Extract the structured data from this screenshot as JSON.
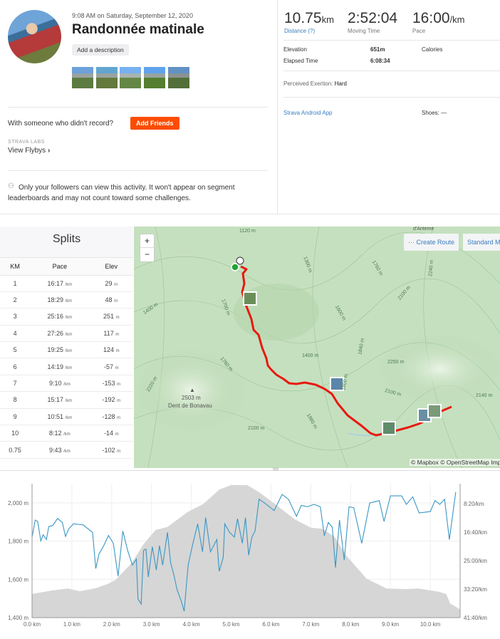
{
  "header": {
    "date": "9:08 AM on Saturday, September 12, 2020",
    "title": "Randonnée matinale",
    "add_description": "Add a description",
    "photo_count": 5
  },
  "friends": {
    "prompt": "With someone who didn't record?",
    "button": "Add Friends"
  },
  "labs": {
    "label": "STRAVA LABS",
    "link": "View Flybys",
    "chevron": "›"
  },
  "privacy": {
    "icon": "followers-icon",
    "text": "Only your followers can view this activity. It won't appear on segment leaderboards and may not count toward some challenges."
  },
  "stats": {
    "distance": {
      "value": "10.75",
      "unit": "km",
      "label": "Distance (?)"
    },
    "moving_time": {
      "value": "2:52:04",
      "label": "Moving Time"
    },
    "pace": {
      "value": "16:00",
      "unit": "/km",
      "label": "Pace"
    },
    "elevation": {
      "label": "Elevation",
      "value": "651m"
    },
    "calories": {
      "label": "Calories"
    },
    "elapsed": {
      "label": "Elapsed Time",
      "value": "6:08:34"
    },
    "exertion": {
      "label": "Perceived Exertion:",
      "value": "Hard"
    },
    "device": "Strava Android App",
    "shoes": {
      "label": "Shoes:",
      "value": "—"
    }
  },
  "splits": {
    "title": "Splits",
    "headers": [
      "KM",
      "Pace",
      "Elev"
    ],
    "pace_unit": "/km",
    "elev_unit": "m",
    "rows": [
      [
        "1",
        "16:17",
        "29"
      ],
      [
        "2",
        "18:29",
        "48"
      ],
      [
        "3",
        "25:16",
        "251"
      ],
      [
        "4",
        "27:26",
        "117"
      ],
      [
        "5",
        "19:25",
        "124"
      ],
      [
        "6",
        "14:19",
        "-57"
      ],
      [
        "7",
        "9:10",
        "-153"
      ],
      [
        "8",
        "15:17",
        "-192"
      ],
      [
        "9",
        "10:51",
        "-128"
      ],
      [
        "10",
        "8:12",
        "-14"
      ],
      [
        "0.75",
        "9:43",
        "-102"
      ]
    ]
  },
  "map": {
    "zoom_in": "+",
    "zoom_out": "−",
    "create_route": "Create Route",
    "standard_map": "Standard Map",
    "attribution": "© Mapbox © OpenStreetMap Improve this map",
    "labels": {
      "peak_elev": "2503 m",
      "peak_name": "Dent de Bonavau",
      "top": "d'Anteme",
      "c1": "1120 m",
      "c2": "1400 m",
      "c3": "1700 m",
      "c4": "1300 m",
      "c5": "1760 m",
      "c6": "2240 m",
      "c7": "2100 m",
      "c8": "1600 m",
      "c9": "1400 m",
      "c10": "1840 m",
      "c11": "2250 m",
      "c12": "1760 m",
      "c13": "2220 m",
      "c14": "2100 m",
      "c15": "1800 m",
      "c16": "2140 m",
      "c17": "2100 m",
      "c18": "1980 m",
      "c19": "140"
    },
    "route_color": "#e8190f",
    "start_color": "#1fa532"
  },
  "chart_data": {
    "type": "area+line",
    "x_ticks": [
      "0.0 km",
      "1.0 km",
      "2.0 km",
      "3.0 km",
      "4.0 km",
      "5.0 km",
      "6.0 km",
      "7.0 km",
      "8.0 km",
      "9.0 km",
      "10.0 km"
    ],
    "y_left_ticks": [
      "1,400 m",
      "1,600 m",
      "1,800 m",
      "2,000 m"
    ],
    "y_right_ticks": [
      "8:20/km",
      "16:40/km",
      "25:00/km",
      "33:20/km",
      "41:40/km"
    ],
    "xlim": [
      0,
      10.75
    ],
    "ylim_elevation": [
      1400,
      2100
    ],
    "ylim_pace_min_per_km": [
      2.45,
      41.67
    ],
    "grid": true,
    "elevation": {
      "color": "#d6d6d6",
      "x": [
        0,
        0.5,
        0.9,
        1.2,
        1.6,
        1.9,
        2.1,
        2.5,
        2.8,
        3.1,
        3.4,
        3.9,
        4.3,
        4.7,
        5.0,
        5.4,
        5.7,
        6.1,
        6.6,
        7.0,
        7.3,
        7.6,
        7.9,
        8.4,
        8.9,
        9.4,
        9.7,
        10.2,
        10.4,
        10.5,
        10.75
      ],
      "y": [
        1524,
        1542,
        1552,
        1538,
        1554,
        1576,
        1598,
        1685,
        1784,
        1858,
        1874,
        1951,
        1994,
        2069,
        2093,
        2093,
        2056,
        1994,
        1914,
        1870,
        1864,
        1821,
        1722,
        1604,
        1552,
        1549,
        1552,
        1536,
        1524,
        1474,
        1443
      ]
    },
    "pace": {
      "color": "#3a96c4",
      "x": [
        0,
        0.08,
        0.14,
        0.22,
        0.28,
        0.36,
        0.42,
        0.52,
        0.64,
        0.76,
        0.84,
        0.92,
        1.04,
        1.28,
        1.52,
        1.6,
        1.68,
        1.8,
        1.92,
        2.04,
        2.16,
        2.28,
        2.4,
        2.52,
        2.62,
        2.66,
        2.74,
        2.8,
        2.86,
        2.92,
        3.02,
        3.12,
        3.2,
        3.28,
        3.4,
        3.48,
        3.56,
        3.64,
        3.76,
        3.82,
        3.92,
        4.02,
        4.16,
        4.28,
        4.36,
        4.48,
        4.64,
        4.7,
        4.8,
        4.84,
        4.96,
        5.08,
        5.16,
        5.28,
        5.36,
        5.44,
        5.52,
        5.6,
        5.7,
        5.84,
        6.08,
        6.28,
        6.44,
        6.64,
        6.76,
        6.92,
        7.08,
        7.24,
        7.34,
        7.44,
        7.54,
        7.62,
        7.72,
        7.84,
        7.96,
        8.08,
        8.28,
        8.48,
        8.72,
        8.84,
        9.0,
        9.28,
        9.4,
        9.56,
        9.72,
        10.0,
        10.12,
        10.24,
        10.36,
        10.48,
        10.64
      ],
      "y": [
        18.1,
        13.1,
        13.5,
        19.2,
        17.4,
        18.8,
        15.0,
        14.7,
        12.6,
        13.8,
        17.9,
        15.7,
        14.2,
        14.5,
        16.7,
        27.3,
        23.1,
        20.6,
        17.6,
        19.9,
        29.5,
        16.3,
        22.0,
        26.3,
        24.5,
        36.2,
        37.7,
        22.0,
        21.6,
        29.8,
        20.9,
        27.7,
        20.6,
        26.3,
        16.7,
        25.6,
        29.1,
        33.4,
        37.3,
        39.8,
        26.3,
        20.9,
        14.2,
        22.4,
        12.4,
        22.4,
        18.8,
        28.1,
        24.1,
        14.2,
        16.7,
        18.1,
        12.7,
        19.9,
        12.4,
        23.4,
        18.1,
        16.3,
        7.0,
        8.1,
        10.3,
        5.6,
        7.0,
        12.0,
        8.8,
        9.2,
        8.5,
        9.2,
        17.7,
        13.8,
        15.2,
        27.0,
        13.1,
        24.8,
        9.2,
        9.5,
        19.9,
        8.1,
        7.4,
        13.5,
        6.0,
        6.0,
        8.5,
        6.3,
        11.0,
        10.6,
        7.4,
        8.5,
        7.0,
        18.8,
        4.9
      ]
    }
  }
}
